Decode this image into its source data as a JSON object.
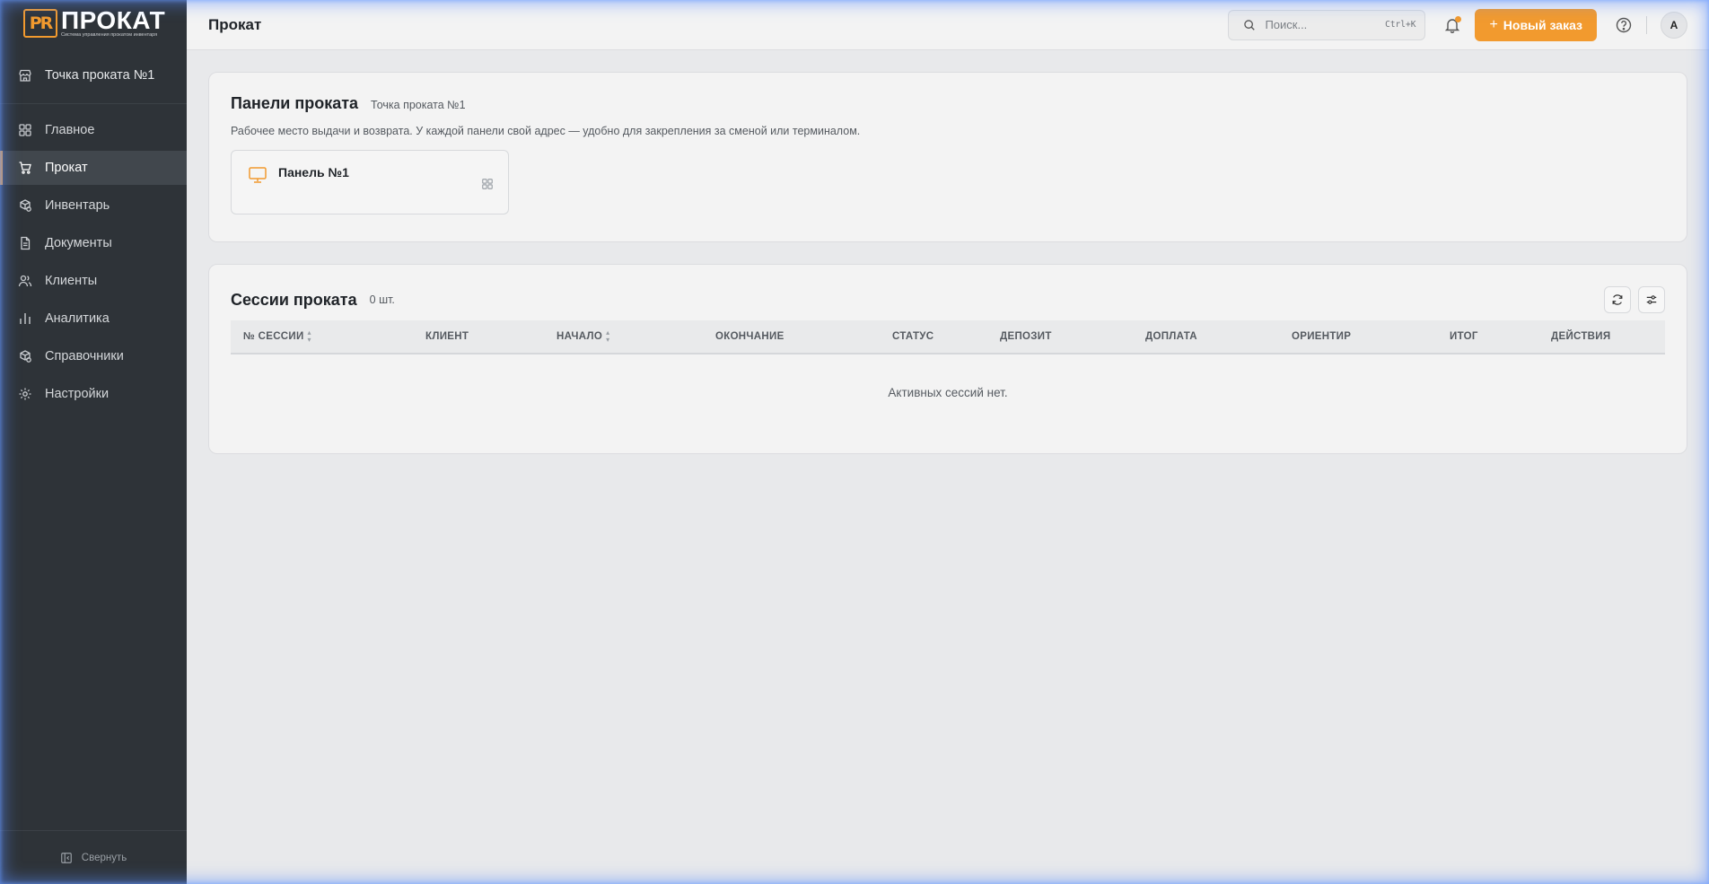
{
  "app": {
    "logo_title": "ПРОКАТ",
    "logo_sub": "Система управления прокатом инвентаря",
    "logo_mark": "PR",
    "accent": "#f29a2e"
  },
  "sidebar": {
    "point": "Точка проката №1",
    "items": [
      {
        "label": "Главное",
        "icon": "grid-icon"
      },
      {
        "label": "Прокат",
        "icon": "cart-icon"
      },
      {
        "label": "Инвентарь",
        "icon": "boxes-icon"
      },
      {
        "label": "Документы",
        "icon": "document-icon"
      },
      {
        "label": "Клиенты",
        "icon": "users-icon"
      },
      {
        "label": "Аналитика",
        "icon": "bar-chart-icon"
      },
      {
        "label": "Справочники",
        "icon": "boxes-icon"
      },
      {
        "label": "Настройки",
        "icon": "gear-icon"
      }
    ],
    "active_index": 1,
    "collapse_label": "Свернуть"
  },
  "topbar": {
    "title": "Прокат",
    "search_placeholder": "Поиск...",
    "search_shortcut": "Ctrl+K",
    "new_order_label": "Новый заказ",
    "avatar_initial": "А"
  },
  "panels": {
    "title": "Панели проката",
    "subtitle": "Точка проката №1",
    "description": "Рабочее место выдачи и возврата. У каждой панели свой адрес — удобно для закрепления за сменой или терминалом.",
    "items": [
      {
        "name": "Панель №1"
      }
    ]
  },
  "sessions": {
    "title": "Сессии проката",
    "count": "0 шт.",
    "columns": [
      {
        "label": "№ СЕССИИ",
        "sortable": true
      },
      {
        "label": "КЛИЕНТ",
        "sortable": false
      },
      {
        "label": "НАЧАЛО",
        "sortable": true
      },
      {
        "label": "ОКОНЧАНИЕ",
        "sortable": false
      },
      {
        "label": "СТАТУС",
        "sortable": false
      },
      {
        "label": "ДЕПОЗИТ",
        "sortable": false
      },
      {
        "label": "ДОПЛАТА",
        "sortable": false
      },
      {
        "label": "ОРИЕНТИР",
        "sortable": false
      },
      {
        "label": "ИТОГ",
        "sortable": false
      },
      {
        "label": "ДЕЙСТВИЯ",
        "sortable": false
      }
    ],
    "empty_text": "Активных сессий нет."
  }
}
